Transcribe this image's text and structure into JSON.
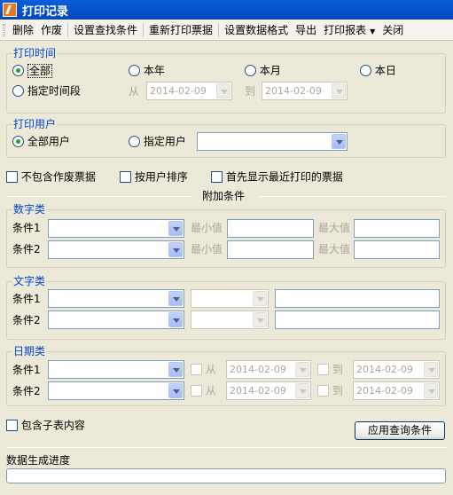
{
  "window": {
    "title": "打印记录"
  },
  "menu": {
    "delete": "删除",
    "void": "作废",
    "set_search": "设置查找条件",
    "reprint": "重新打印票据",
    "set_format": "设置数据格式",
    "export": "导出",
    "print_report": "打印报表",
    "close": "关闭"
  },
  "print_time": {
    "title": "打印时间",
    "all": "全部",
    "this_year": "本年",
    "this_month": "本月",
    "today": "本日",
    "custom_range": "指定时间段",
    "from_label": "从",
    "to_label": "到",
    "from_date": "2014-02-09",
    "to_date": "2014-02-09",
    "selected": "all"
  },
  "print_user": {
    "title": "打印用户",
    "all_users": "全部用户",
    "specific_user": "指定用户",
    "user_value": "",
    "selected": "all_users"
  },
  "options": {
    "exclude_void": "不包含作废票据",
    "sort_by_user": "按用户排序",
    "recent_first": "首先显示最近打印的票据"
  },
  "extra": {
    "title": "附加条件",
    "numeric": {
      "title": "数字类",
      "cond1": "条件1",
      "cond2": "条件2",
      "min": "最小值",
      "max": "最大值"
    },
    "text": {
      "title": "文字类",
      "cond1": "条件1",
      "cond2": "条件2"
    },
    "date": {
      "title": "日期类",
      "cond1": "条件1",
      "cond2": "条件2",
      "from": "从",
      "to": "到",
      "date1_from": "2014-02-09",
      "date1_to": "2014-02-09",
      "date2_from": "2014-02-09",
      "date2_to": "2014-02-09"
    }
  },
  "include_subtable": "包含子表内容",
  "apply_button": "应用查询条件",
  "progress": {
    "label": "数据生成进度",
    "value": 0
  }
}
